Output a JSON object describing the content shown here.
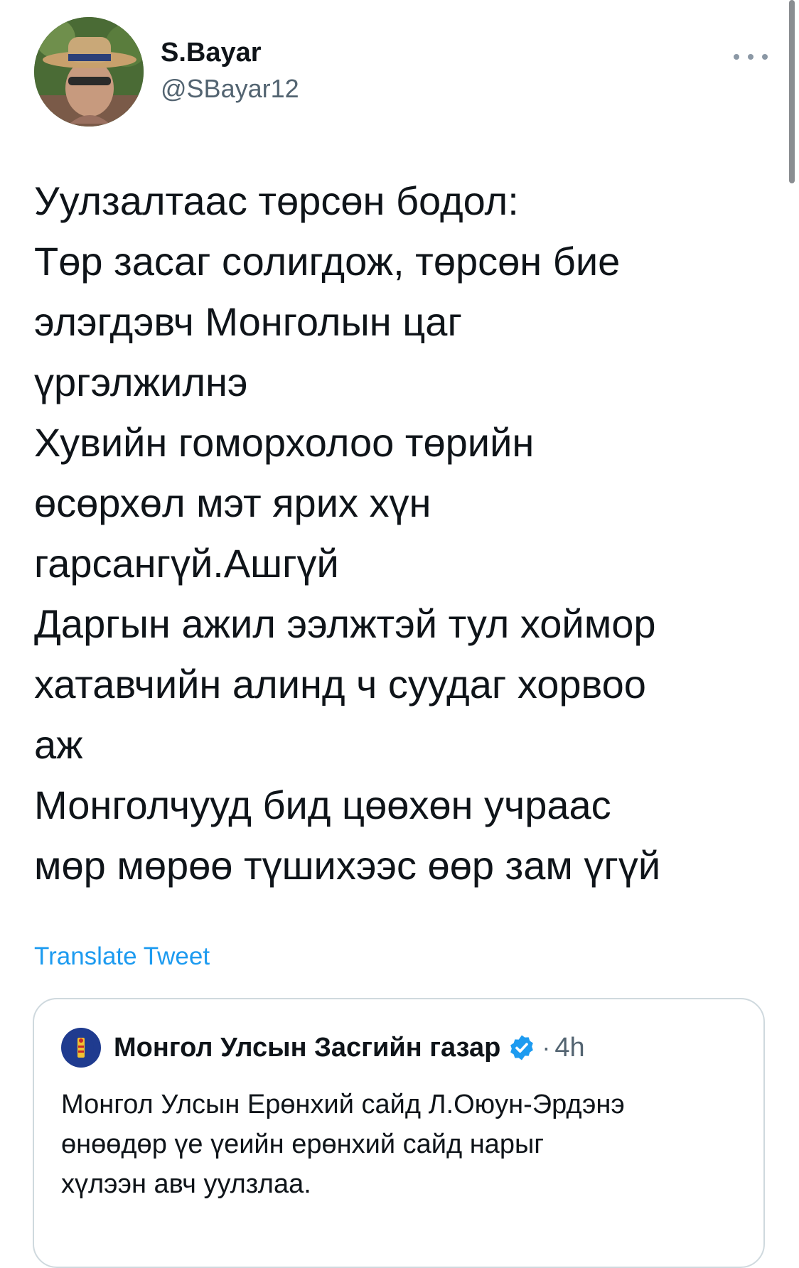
{
  "tweet": {
    "author": {
      "display_name": "S.Bayar",
      "handle": "@SBayar12"
    },
    "more_icon": "more-horizontal-icon",
    "lines": [
      "Уулзалтаас төрсөн бодол:",
      "Төр засаг солигдож, төрсөн бие",
      "элэгдэвч Монголын цаг",
      "үргэлжилнэ",
      "Хувийн гоморхолоо төрийн",
      "өсөрхөл мэт ярих хүн",
      "гарсангүй.Ашгүй",
      "Даргын ажил ээлжтэй тул хоймор",
      "хатавчийн алинд ч суудаг хорвоо",
      "аж",
      "Монголчууд бид цөөхөн учраас",
      "мөр мөрөө түшихээс өөр зам үгүй"
    ],
    "translate_label": "Translate Tweet"
  },
  "quoted_tweet": {
    "display_name": "Монгол Улсын Засгийн газар",
    "verified_icon": "verified-badge-icon",
    "separator": "·",
    "time": "4h",
    "lines": [
      "Монгол Улсын Ерөнхий сайд Л.Оюун-Эрдэнэ",
      "өнөөдөр үе үеийн ерөнхий сайд нарыг",
      "хүлээн авч уулзлаа."
    ]
  },
  "colors": {
    "text_primary": "#0f1419",
    "text_secondary": "#536471",
    "link": "#1d9bf0",
    "border": "#cfd9de",
    "verified": "#1d9bf0"
  }
}
